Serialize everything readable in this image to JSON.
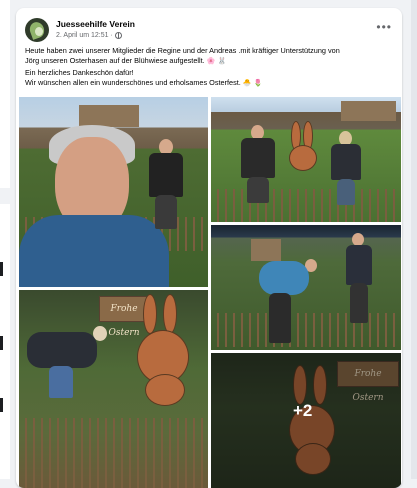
{
  "post": {
    "author": "Juesseehilfe Verein",
    "date": "2. April um 12:51",
    "privacy_icon": "globe-icon",
    "more_icon": "ellipsis-icon",
    "lines": [
      "Heute haben zwei unserer Mitglieder die Regine und der  Andreas .mit kräftiger Unterstützung von",
      "Jörg   unseren Osterhasen auf der Blühwiese aufgestellt.",
      "Ein herzliches Dankeschön dafür!",
      "Wir wünschen allen ein wunderschönes und erholsames Osterfest."
    ],
    "emojis": [
      "🌸",
      "🐰",
      "🐣",
      "🌷"
    ]
  },
  "photos": {
    "sign_text_1": "Frohe Ostern",
    "sign_text_2": "Frohe Ostern",
    "more_count": "+2"
  }
}
